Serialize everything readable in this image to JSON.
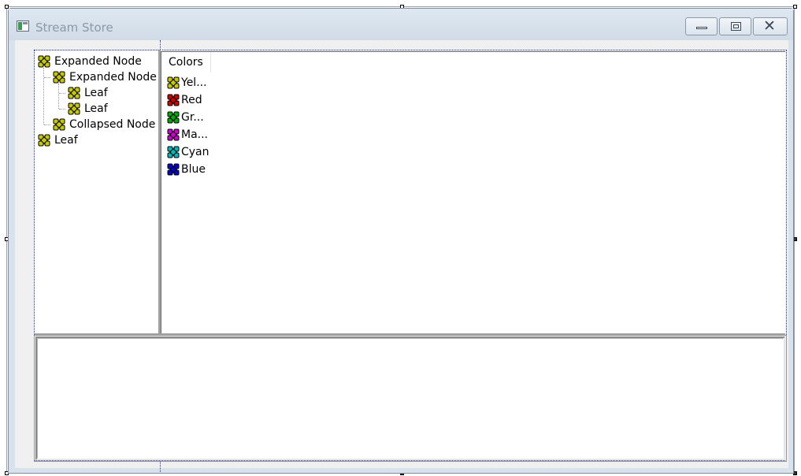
{
  "window": {
    "title": "Stream Store",
    "buttons": {
      "minimize": "minimize-button",
      "maximize": "maximize-button",
      "close": "close-button"
    }
  },
  "tree": {
    "items": [
      {
        "label": "Expanded Node",
        "icon": "node-icon",
        "color": "#c8c800"
      },
      {
        "label": "Expanded Node",
        "icon": "node-icon",
        "color": "#c8c800"
      },
      {
        "label": "Leaf",
        "icon": "leaf-icon",
        "color": "#c8c800"
      },
      {
        "label": "Leaf",
        "icon": "leaf-icon",
        "color": "#c8c800"
      },
      {
        "label": "Collapsed Node",
        "icon": "node-icon",
        "color": "#c8c800"
      },
      {
        "label": "Leaf",
        "icon": "leaf-icon",
        "color": "#c8c800"
      }
    ]
  },
  "list": {
    "column_header": "Colors",
    "items": [
      {
        "label": "Yel...",
        "icon": "yellow-icon",
        "color": "#c8c800"
      },
      {
        "label": "Red",
        "icon": "red-icon",
        "color": "#cc0000"
      },
      {
        "label": "Gr...",
        "icon": "green-icon",
        "color": "#00aa00"
      },
      {
        "label": "Ma...",
        "icon": "magenta-icon",
        "color": "#cc00cc"
      },
      {
        "label": "Cyan",
        "icon": "cyan-icon",
        "color": "#00b8b8"
      },
      {
        "label": "Blue",
        "icon": "blue-icon",
        "color": "#0000cc"
      }
    ]
  },
  "textbox": {
    "value": ""
  }
}
